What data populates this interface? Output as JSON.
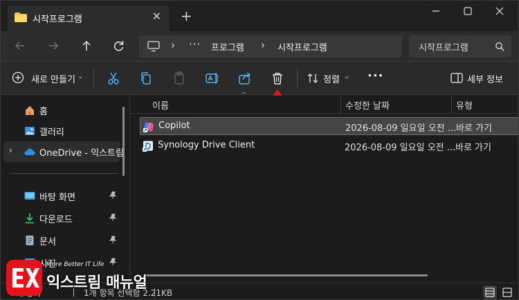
{
  "tab": {
    "title": "시작프로그램",
    "close_icon": "close-icon",
    "new_tab_icon": "plus-icon"
  },
  "window_controls": [
    "minimize-icon",
    "maximize-icon",
    "close-icon"
  ],
  "address": {
    "breadcrumb": [
      "프로그램",
      "시작프로그램"
    ],
    "overflow": "···",
    "search_placeholder": "시작프로그램"
  },
  "commandbar": {
    "new_label": "새로 만들기",
    "sort_label": "정렬",
    "more_label": "···",
    "details_label": "세부 정보",
    "icons": [
      "cut-icon",
      "copy-icon",
      "paste-icon",
      "rename-icon",
      "share-icon",
      "delete-icon"
    ]
  },
  "sidebar": {
    "items": [
      {
        "label": "홈",
        "icon": "home-icon"
      },
      {
        "label": "갤러리",
        "icon": "gallery-icon"
      },
      {
        "label": "OneDrive - 익스트림",
        "icon": "cloud-icon",
        "selected": true
      },
      {
        "label": "바탕 화면",
        "icon": "desktop-icon",
        "pinned": true
      },
      {
        "label": "다운로드",
        "icon": "download-icon",
        "pinned": true
      },
      {
        "label": "문서",
        "icon": "document-icon",
        "pinned": true
      },
      {
        "label": "사진",
        "icon": "pictures-icon",
        "pinned": true
      }
    ]
  },
  "columns": {
    "name": "이름",
    "modified": "수정한 날짜",
    "type": "유형"
  },
  "files": [
    {
      "name": "Copilot",
      "modified": "2026-08-09 일요일 오전 ...",
      "type": "바로 가기",
      "selected": true
    },
    {
      "name": "Synology Drive Client",
      "modified": "2026-08-09 일요일 오전 ...",
      "type": "바로 가기",
      "selected": false
    }
  ],
  "status": {
    "count": "2개 항목",
    "selection": "1개 항목 선택함 2.21KB"
  },
  "watermark": {
    "tagline": "More Better IT Life",
    "name": "익스트림 매뉴얼"
  },
  "colors": {
    "accent_red": "#e8101a",
    "selection_bg": "#454545",
    "window_bg": "#1c1c1c"
  }
}
